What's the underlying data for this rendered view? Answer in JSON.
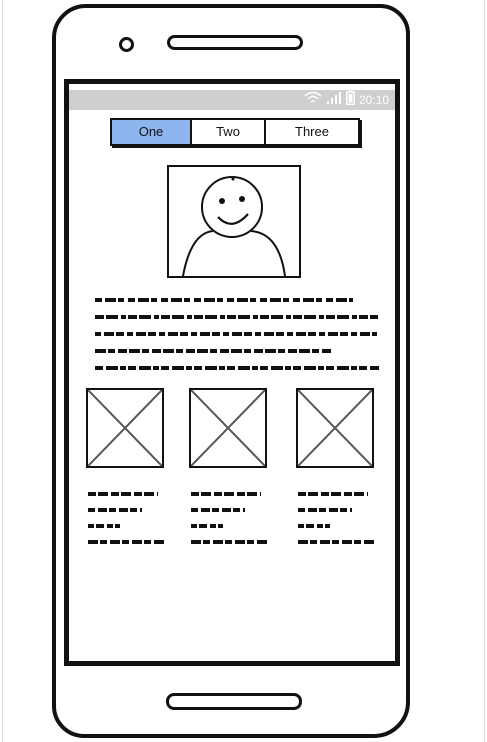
{
  "status_bar": {
    "time": "20:10",
    "icons": [
      "wifi-icon",
      "signal-icon",
      "battery-icon"
    ]
  },
  "tabs": [
    {
      "label": "One",
      "selected": true
    },
    {
      "label": "Two",
      "selected": false
    },
    {
      "label": "Three",
      "selected": false
    }
  ],
  "avatar": {
    "icon": "smiley-person-icon"
  },
  "paragraph": {
    "lines": 5
  },
  "gallery": {
    "items": [
      {
        "icon": "image-placeholder-icon",
        "caption_lines": 4
      },
      {
        "icon": "image-placeholder-icon",
        "caption_lines": 4
      },
      {
        "icon": "image-placeholder-icon",
        "caption_lines": 4
      }
    ]
  },
  "colors": {
    "selected_tab": "#8db4ec",
    "status_bar": "#cfcfcf",
    "ink": "#111111"
  }
}
